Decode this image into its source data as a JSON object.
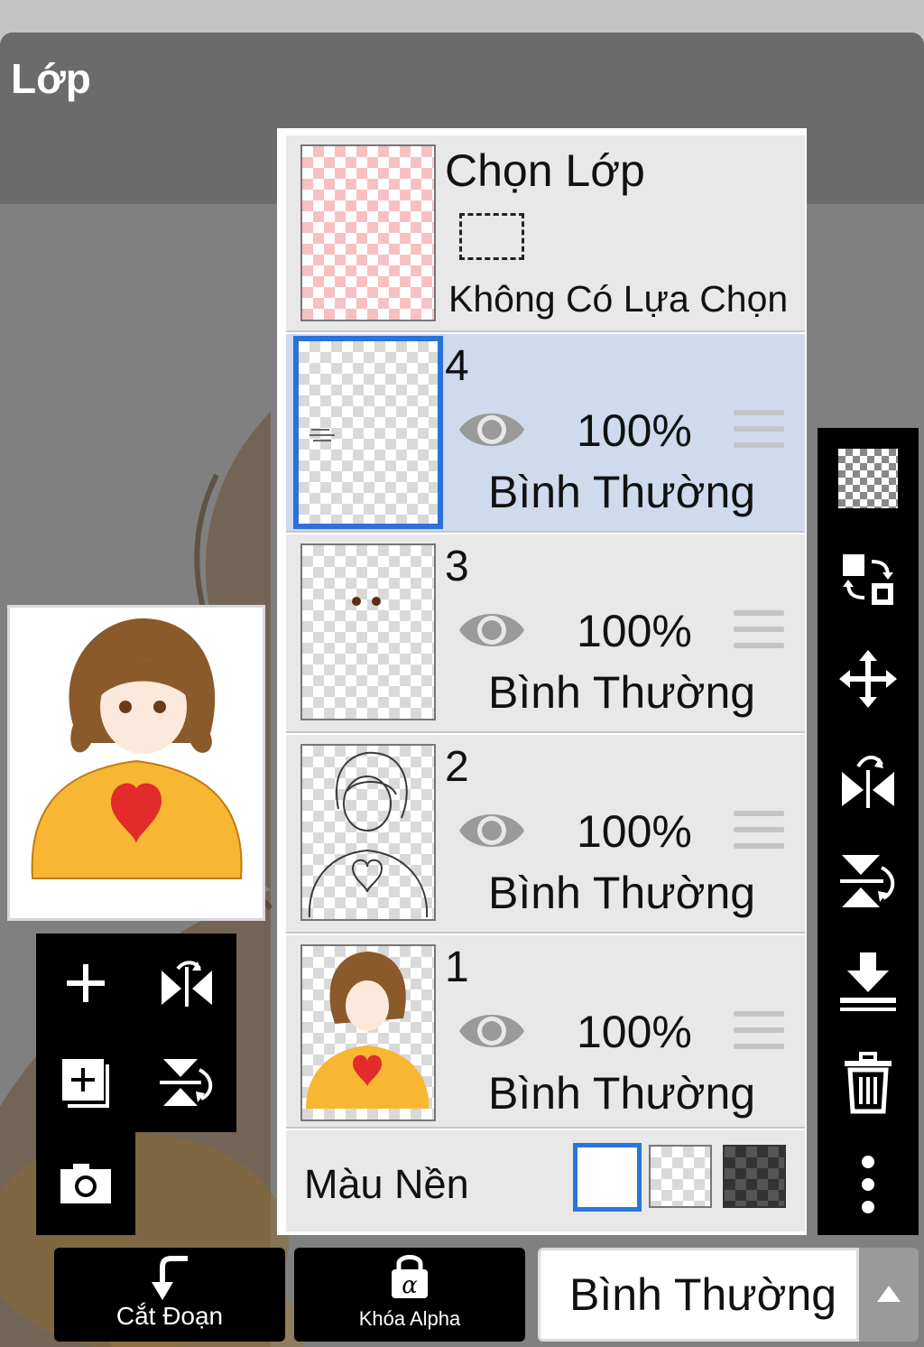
{
  "dialog": {
    "title": "Lớp"
  },
  "selection_row": {
    "title": "Chọn Lớp",
    "status": "Không Có Lựa Chọn"
  },
  "layers": [
    {
      "number": "4",
      "opacity": "100%",
      "blend": "Bình Thường",
      "selected": true
    },
    {
      "number": "3",
      "opacity": "100%",
      "blend": "Bình Thường",
      "selected": false
    },
    {
      "number": "2",
      "opacity": "100%",
      "blend": "Bình Thường",
      "selected": false
    },
    {
      "number": "1",
      "opacity": "100%",
      "blend": "Bình Thường",
      "selected": false
    }
  ],
  "background_row": {
    "label": "Màu Nền",
    "options": [
      "white",
      "transparent",
      "dark-checker"
    ],
    "selected": "white"
  },
  "bottom_bar": {
    "cut_label": "Cắt Đoạn",
    "alpha_lock_label": "Khóa Alpha",
    "blend_mode": "Bình Thường"
  },
  "colors": {
    "accent": "#2a74d9",
    "selected_row": "#cfdaec",
    "hair": "#8a5a2b",
    "sweater": "#f7b733",
    "heart": "#e32b2b"
  },
  "icons": {
    "left_tools": [
      "plus-icon",
      "flip-horizontal-icon",
      "add-layer-icon",
      "flip-vertical-icon",
      "camera-icon"
    ],
    "right_tools": [
      "transparency-icon",
      "swap-layers-icon",
      "move-icon",
      "flip-horizontal-icon",
      "flip-vertical-icon",
      "merge-down-icon",
      "trash-icon",
      "more-icon"
    ]
  }
}
